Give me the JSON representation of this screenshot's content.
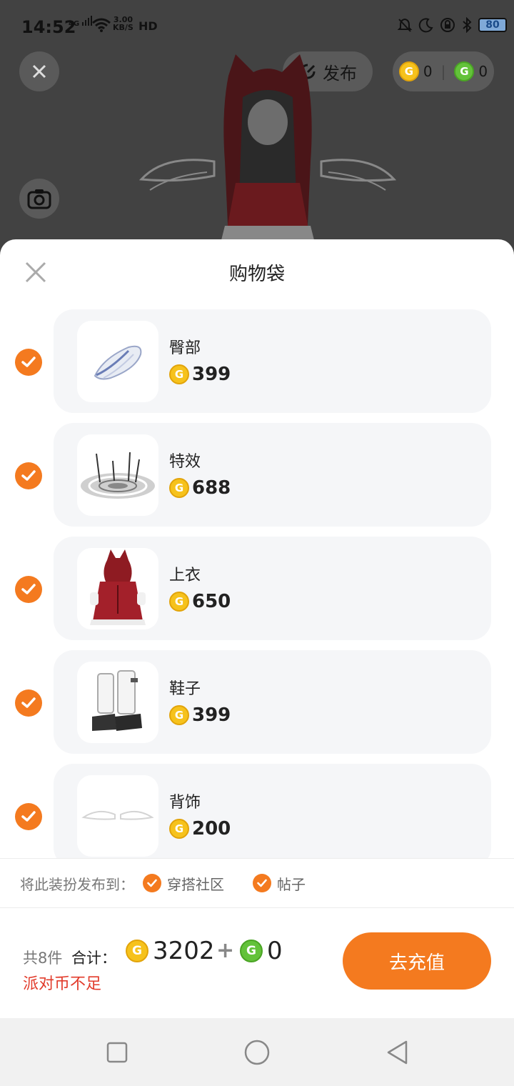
{
  "status_bar": {
    "time": "14:52",
    "network": "4G",
    "speed_value": "3.00",
    "speed_unit": "KB/S",
    "hd": "HD",
    "battery": "80"
  },
  "top_bar": {
    "publish_label": "发布",
    "gold_coins": "0",
    "green_coins": "0"
  },
  "sheet": {
    "title": "购物袋",
    "items": [
      {
        "name": "臀部",
        "price": "399",
        "checked": true,
        "icon": "tail-icon"
      },
      {
        "name": "特效",
        "price": "688",
        "checked": true,
        "icon": "magic-circle-icon"
      },
      {
        "name": "上衣",
        "price": "650",
        "checked": true,
        "icon": "red-dress-icon"
      },
      {
        "name": "鞋子",
        "price": "399",
        "checked": true,
        "icon": "boots-icon"
      },
      {
        "name": "背饰",
        "price": "200",
        "checked": true,
        "icon": "wings-icon"
      }
    ],
    "publish_to": {
      "label": "将此装扮发布到：",
      "options": [
        "穿搭社区",
        "帖子"
      ]
    },
    "footer": {
      "count_label": "共8件",
      "total_label": "合计：",
      "gold_total": "3202",
      "plus": "+",
      "green_total": "0",
      "warning": "派对币不足",
      "recharge_label": "去充值"
    }
  },
  "colors": {
    "accent": "#f47a1f",
    "gold_coin": "#f6c21c",
    "green_coin": "#63c23a",
    "warning": "#e23b2b"
  }
}
